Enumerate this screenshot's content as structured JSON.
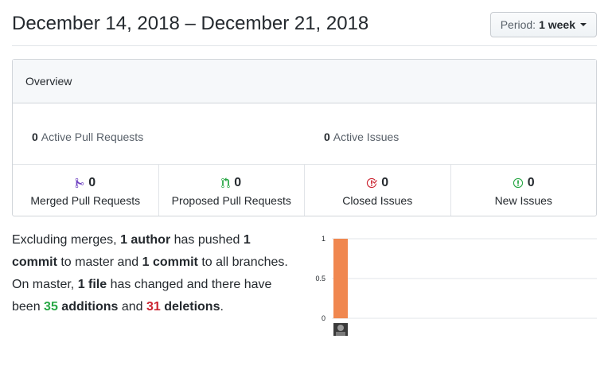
{
  "header": {
    "date_range": "December 14, 2018 – December 21, 2018",
    "period_label": "Period:",
    "period_value": "1 week"
  },
  "overview": {
    "title": "Overview",
    "active_prs": {
      "count": "0",
      "label": "Active Pull Requests"
    },
    "active_issues": {
      "count": "0",
      "label": "Active Issues"
    },
    "stats": [
      {
        "icon": "git-merge-icon",
        "count": "0",
        "label": "Merged Pull Requests",
        "color": "#6f42c1"
      },
      {
        "icon": "git-pull-request-icon",
        "count": "0",
        "label": "Proposed Pull Requests",
        "color": "#28a745"
      },
      {
        "icon": "issue-closed-icon",
        "count": "0",
        "label": "Closed Issues",
        "color": "#cb2431"
      },
      {
        "icon": "issue-opened-icon",
        "count": "0",
        "label": "New Issues",
        "color": "#28a745"
      }
    ]
  },
  "narrative": {
    "p1": "Excluding merges, ",
    "authors": "1 author",
    "p2": " has pushed ",
    "commits_master": "1 commit",
    "p3": " to master and ",
    "commits_all": "1 commit",
    "p4": " to all branches. On master, ",
    "files": "1 file",
    "p5": " has changed and there have been ",
    "additions_num": "35",
    "additions_word": " additions",
    "p6": " and ",
    "deletions_num": "31",
    "deletions_word": " deletions",
    "p7": "."
  },
  "chart_data": {
    "type": "bar",
    "categories": [
      "author"
    ],
    "values": [
      1
    ],
    "ylim": [
      0,
      1
    ],
    "yticks": [
      "1",
      "0.5",
      "0"
    ],
    "bar_color": "#f0874f",
    "grid": true
  }
}
